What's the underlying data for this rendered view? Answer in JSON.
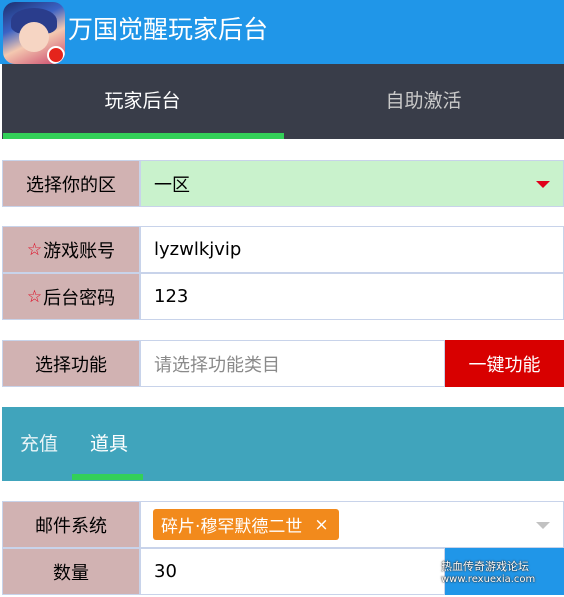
{
  "header": {
    "title": "万国觉醒玩家后台"
  },
  "topnav": {
    "tabs": [
      {
        "label": "玩家后台"
      },
      {
        "label": "自助激活"
      }
    ]
  },
  "form": {
    "zone": {
      "label": "选择你的区",
      "value": "一区"
    },
    "account": {
      "label": "游戏账号",
      "required_mark": "☆",
      "value": "lyzwlkjvip"
    },
    "password": {
      "label": "后台密码",
      "required_mark": "☆",
      "value": "123"
    },
    "function": {
      "label": "选择功能",
      "placeholder": "请选择功能类目",
      "button": "一键功能"
    }
  },
  "subtabs": [
    {
      "label": "充值"
    },
    {
      "label": "道具"
    }
  ],
  "mail": {
    "label": "邮件系统",
    "tag": "碎片·穆罕默德二世",
    "tag_remove": "×"
  },
  "quantity": {
    "label": "数量",
    "value": "30"
  },
  "watermark": {
    "line1": "热血传奇游戏论坛",
    "line2": "www.rexuexia.com"
  },
  "colors": {
    "header": "#2096e8",
    "nav": "#393d49",
    "accent_green": "#33d058",
    "danger": "#d80000",
    "tag": "#f28a1c",
    "subtab_bg": "#40a4bc"
  }
}
